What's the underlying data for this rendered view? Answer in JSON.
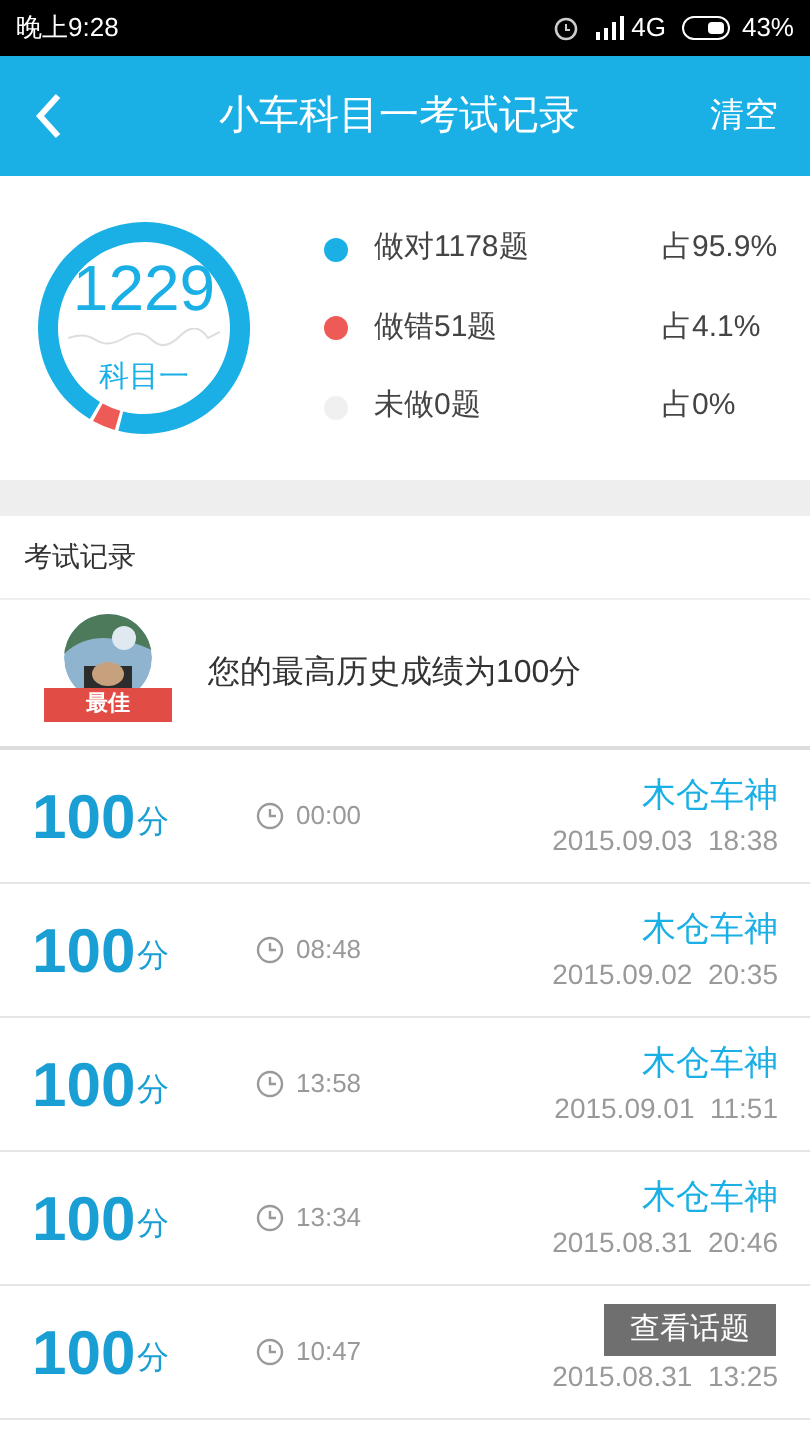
{
  "status_bar": {
    "time": "晚上9:28",
    "network": "4G",
    "battery": "43%"
  },
  "header": {
    "title": "小车科目一考试记录",
    "action": "清空"
  },
  "summary": {
    "total": "1229",
    "subject": "科目一",
    "chart_data": {
      "type": "donut",
      "values": [
        95.9,
        4.1,
        0
      ]
    },
    "legend": [
      {
        "label": "做对1178题",
        "share": "占95.9%",
        "color": "#1ab0e6"
      },
      {
        "label": "做错51题",
        "share": "占4.1%",
        "color": "#ee5a55"
      },
      {
        "label": "未做0题",
        "share": "占0%",
        "color": "#f0f0f0"
      }
    ]
  },
  "section_title": "考试记录",
  "best": {
    "badge": "最佳",
    "text": "您的最高历史成绩为100分"
  },
  "records": [
    {
      "score": "100",
      "unit": "分",
      "duration": "00:00",
      "name": "木仓车神",
      "date": "2015.09.03  18:38"
    },
    {
      "score": "100",
      "unit": "分",
      "duration": "08:48",
      "name": "木仓车神",
      "date": "2015.09.02  20:35"
    },
    {
      "score": "100",
      "unit": "分",
      "duration": "13:58",
      "name": "木仓车神",
      "date": "2015.09.01  11:51"
    },
    {
      "score": "100",
      "unit": "分",
      "duration": "13:34",
      "name": "木仓车神",
      "date": "2015.08.31  20:46"
    },
    {
      "score": "100",
      "unit": "分",
      "duration": "10:47",
      "date": "2015.08.31  13:25"
    }
  ],
  "overlay_button": "查看话题"
}
